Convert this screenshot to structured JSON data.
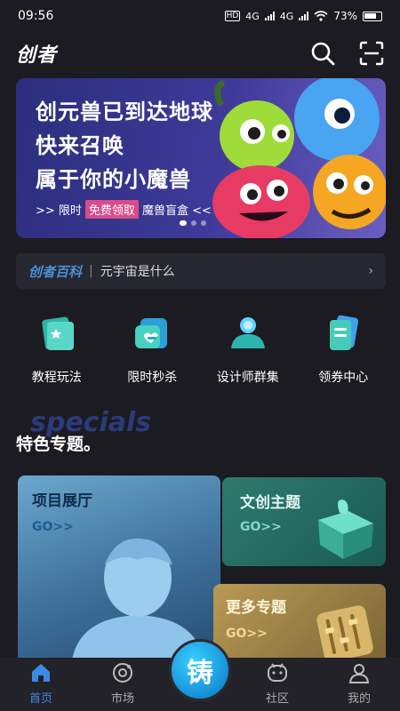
{
  "status_bar": {
    "time": "09:56",
    "hd": "HD",
    "net1": "4G",
    "net2": "4G",
    "battery": "73%"
  },
  "header": {
    "logo": "创者",
    "icons": [
      "search-icon",
      "scan-icon"
    ]
  },
  "banner": {
    "lines": [
      "创元兽已到达地球",
      "快来召唤",
      "属于你的小魔兽"
    ],
    "sub_prefix": ">> 限时",
    "sub_highlight": "免费领取",
    "sub_suffix": "魔兽盲盒 <<",
    "dot_count": 3,
    "active_dot": 0
  },
  "notice": {
    "brand": "创者百科",
    "separator": "|",
    "text": "元宇宙是什么",
    "arrow": "›"
  },
  "quick_actions": [
    {
      "label": "教程玩法",
      "icon": "tutorial-icon"
    },
    {
      "label": "限时秒杀",
      "icon": "flash-sale-icon"
    },
    {
      "label": "设计师群集",
      "icon": "designer-icon"
    },
    {
      "label": "领券中心",
      "icon": "coupon-icon"
    }
  ],
  "section": {
    "bg_text": "specials",
    "title": "特色专题。"
  },
  "cards": [
    {
      "title": "项目展厅",
      "go": "GO>>"
    },
    {
      "title": "文创主题",
      "go": "GO>>"
    },
    {
      "title": "更多专题",
      "go": "GO>>"
    }
  ],
  "tabbar": {
    "tabs": [
      {
        "label": "首页",
        "icon": "home-icon",
        "active": true
      },
      {
        "label": "市场",
        "icon": "market-icon",
        "active": false
      },
      {
        "label": "社区",
        "icon": "community-icon",
        "active": false
      },
      {
        "label": "我的",
        "icon": "profile-icon",
        "active": false
      }
    ],
    "center_label": "铸"
  },
  "colors": {
    "background": "#1c1b21",
    "accent": "#3a8be8",
    "brand_blue": "#4a8fd9"
  }
}
